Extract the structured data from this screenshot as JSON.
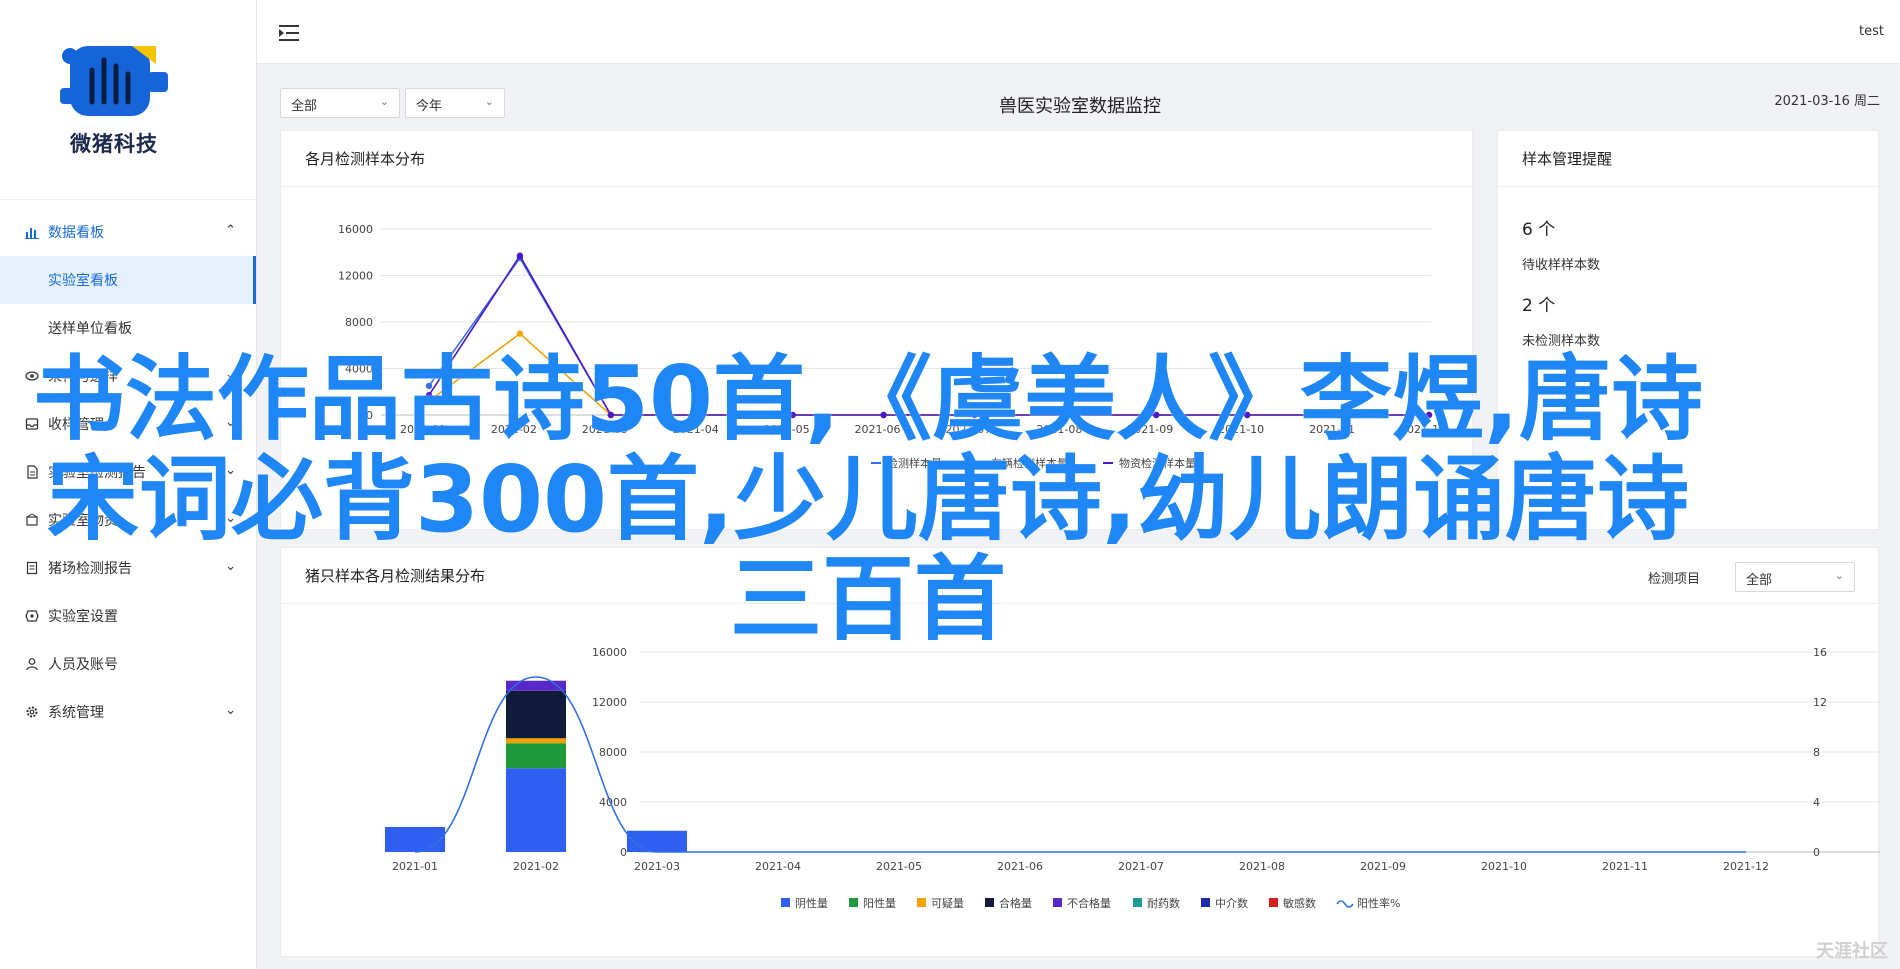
{
  "app": {
    "logo_text": "微猪科技",
    "user": "test"
  },
  "sidebar": {
    "items": [
      {
        "label": "数据看板",
        "icon": "bar-chart-icon",
        "has_children": true,
        "expanded": true
      },
      {
        "label": "实验室看板",
        "sub": true,
        "active": true
      },
      {
        "label": "送样单位看板",
        "sub": true
      },
      {
        "label": "采样与送样",
        "icon": "eye-icon",
        "has_children": true
      },
      {
        "label": "收样管理",
        "icon": "inbox-icon",
        "has_children": true
      },
      {
        "label": "实验室检测报告",
        "icon": "document-icon",
        "has_children": true
      },
      {
        "label": "实验室物资",
        "icon": "box-icon",
        "has_children": true
      },
      {
        "label": "猪场检测报告",
        "icon": "report-icon",
        "has_children": true
      },
      {
        "label": "实验室设置",
        "icon": "settings-icon"
      },
      {
        "label": "人员及账号",
        "icon": "user-icon"
      },
      {
        "label": "系统管理",
        "icon": "gear-icon",
        "has_children": true
      }
    ]
  },
  "filters": {
    "scope": "全部",
    "period": "今年"
  },
  "page": {
    "title": "兽医实验室数据监控",
    "date": "2021-03-16 周二"
  },
  "monthly": {
    "title": "各月检测样本分布"
  },
  "remind": {
    "title": "样本管理提醒",
    "pending_value": "6 个",
    "pending_label": "待收样样本数",
    "unsent_value": "2 个",
    "unsent_label": "未检测样本数"
  },
  "results": {
    "title": "猪只样本各月检测结果分布",
    "filter_label": "检测项目",
    "filter_value": "全部"
  },
  "banner": {
    "line1": "书法作品古诗50首,《虞美人》李煜,唐诗",
    "line2": "宋词必背300首,少儿唐诗,幼儿朗诵唐诗",
    "line3": "三百首"
  },
  "watermark": "天涯社区",
  "chart_data": [
    {
      "type": "line",
      "categories": [
        "2021-01",
        "2021-02",
        "2021-03",
        "2021-04",
        "2021-05",
        "2021-06",
        "2021-07",
        "2021-08",
        "2021-09",
        "2021-10",
        "2021-11",
        "2021-12"
      ],
      "ylim": [
        0,
        16000
      ],
      "yticks": [
        0,
        4000,
        8000,
        12000,
        16000
      ],
      "series": [
        {
          "name": "检测样本量",
          "color": "#3b6fe8",
          "values": [
            2500,
            13500,
            0,
            0,
            0,
            0,
            0,
            0,
            0,
            0,
            0,
            0
          ]
        },
        {
          "name": "车辆检测样本量",
          "color": "#f0a30a",
          "values": [
            1200,
            7000,
            0,
            0,
            0,
            0,
            0,
            0,
            0,
            0,
            0,
            0
          ]
        },
        {
          "name": "物资检测样本量",
          "color": "#4a17c9",
          "values": [
            1700,
            13700,
            0,
            0,
            0,
            0,
            0,
            0,
            0,
            0,
            0,
            0
          ]
        }
      ]
    },
    {
      "type": "bar",
      "stacked": true,
      "categories": [
        "2021-01",
        "2021-02",
        "2021-03",
        "2021-04",
        "2021-05",
        "2021-06",
        "2021-07",
        "2021-08",
        "2021-09",
        "2021-10",
        "2021-11",
        "2021-12"
      ],
      "ylim": [
        0,
        16000
      ],
      "yticks": [
        0,
        4000,
        8000,
        12000,
        16000
      ],
      "y2lim": [
        0,
        16
      ],
      "y2ticks": [
        0,
        4,
        8,
        12,
        16
      ],
      "series": [
        {
          "name": "阴性量",
          "color": "#2f5ff0",
          "values": [
            2000,
            6700,
            1700,
            0,
            0,
            0,
            0,
            0,
            0,
            0,
            0,
            0
          ]
        },
        {
          "name": "阳性量",
          "color": "#1e9a3c",
          "values": [
            0,
            2000,
            0,
            0,
            0,
            0,
            0,
            0,
            0,
            0,
            0,
            0
          ]
        },
        {
          "name": "可疑量",
          "color": "#f5a300",
          "values": [
            0,
            400,
            0,
            0,
            0,
            0,
            0,
            0,
            0,
            0,
            0,
            0
          ]
        },
        {
          "name": "合格量",
          "color": "#121a3a",
          "values": [
            0,
            3800,
            0,
            0,
            0,
            0,
            0,
            0,
            0,
            0,
            0,
            0
          ]
        },
        {
          "name": "不合格量",
          "color": "#5a28c8",
          "values": [
            0,
            800,
            0,
            0,
            0,
            0,
            0,
            0,
            0,
            0,
            0,
            0
          ]
        },
        {
          "name": "耐药数",
          "color": "#1b9c96",
          "values": [
            0,
            0,
            0,
            0,
            0,
            0,
            0,
            0,
            0,
            0,
            0,
            0
          ]
        },
        {
          "name": "中介数",
          "color": "#1a2aa8",
          "values": [
            0,
            0,
            0,
            0,
            0,
            0,
            0,
            0,
            0,
            0,
            0,
            0
          ]
        },
        {
          "name": "敏感数",
          "color": "#d62020",
          "values": [
            0,
            0,
            0,
            0,
            0,
            0,
            0,
            0,
            0,
            0,
            0,
            0
          ]
        }
      ],
      "line_series": {
        "name": "阳性率%",
        "color": "#2f6fe8",
        "values": [
          0,
          14,
          0,
          0,
          0,
          0,
          0,
          0,
          0,
          0,
          0,
          0
        ]
      }
    }
  ]
}
